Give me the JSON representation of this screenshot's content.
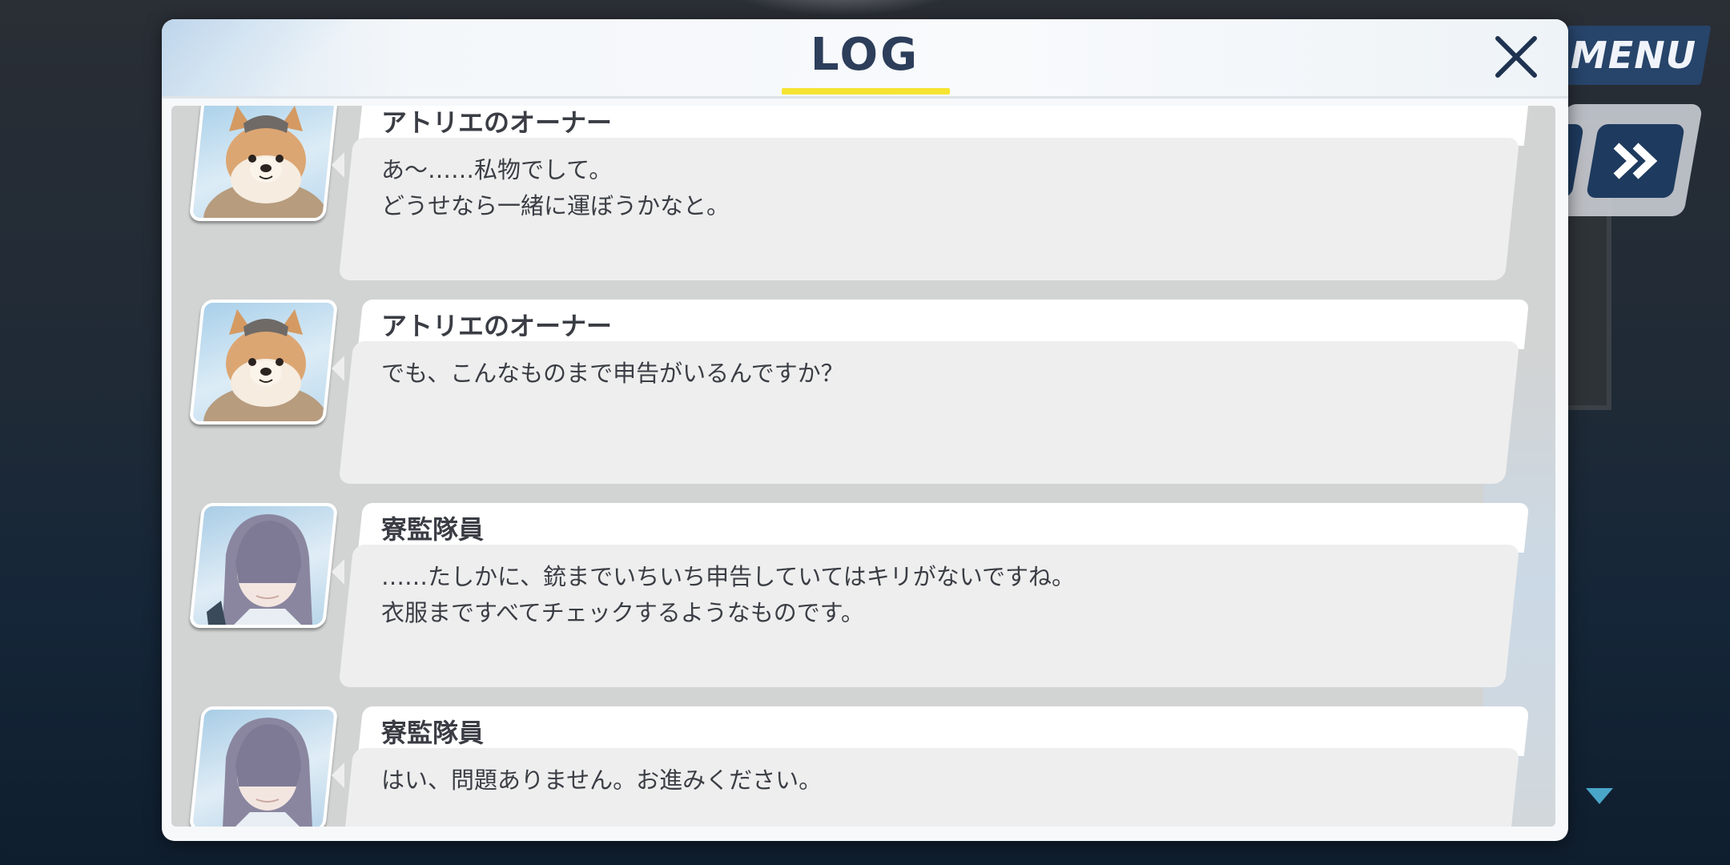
{
  "menu": {
    "label": "MENU"
  },
  "log": {
    "title": "LOG",
    "entries": [
      {
        "speaker": "アトリエのオーナー",
        "avatar": "dog",
        "lines": [
          "あ～……私物でして。",
          "どうせなら一緒に運ぼうかなと。"
        ]
      },
      {
        "speaker": "アトリエのオーナー",
        "avatar": "dog",
        "lines": [
          "でも、こんなものまで申告がいるんですか？"
        ]
      },
      {
        "speaker": "寮監隊員",
        "avatar": "girl",
        "lines": [
          "……たしかに、銃までいちいち申告していてはキリがないですね。",
          "衣服まですべてチェックするようなものです。"
        ]
      },
      {
        "speaker": "寮監隊員",
        "avatar": "girl",
        "lines": [
          "はい、問題ありません。お進みください。"
        ]
      }
    ]
  },
  "icons": {
    "close": "close-icon",
    "fast_forward": "fast-forward-icon",
    "scroll_down": "triangle-down-icon"
  },
  "colors": {
    "title": "#2c3e5a",
    "underline": "#f5e432",
    "menu_bg": "#27446a"
  }
}
